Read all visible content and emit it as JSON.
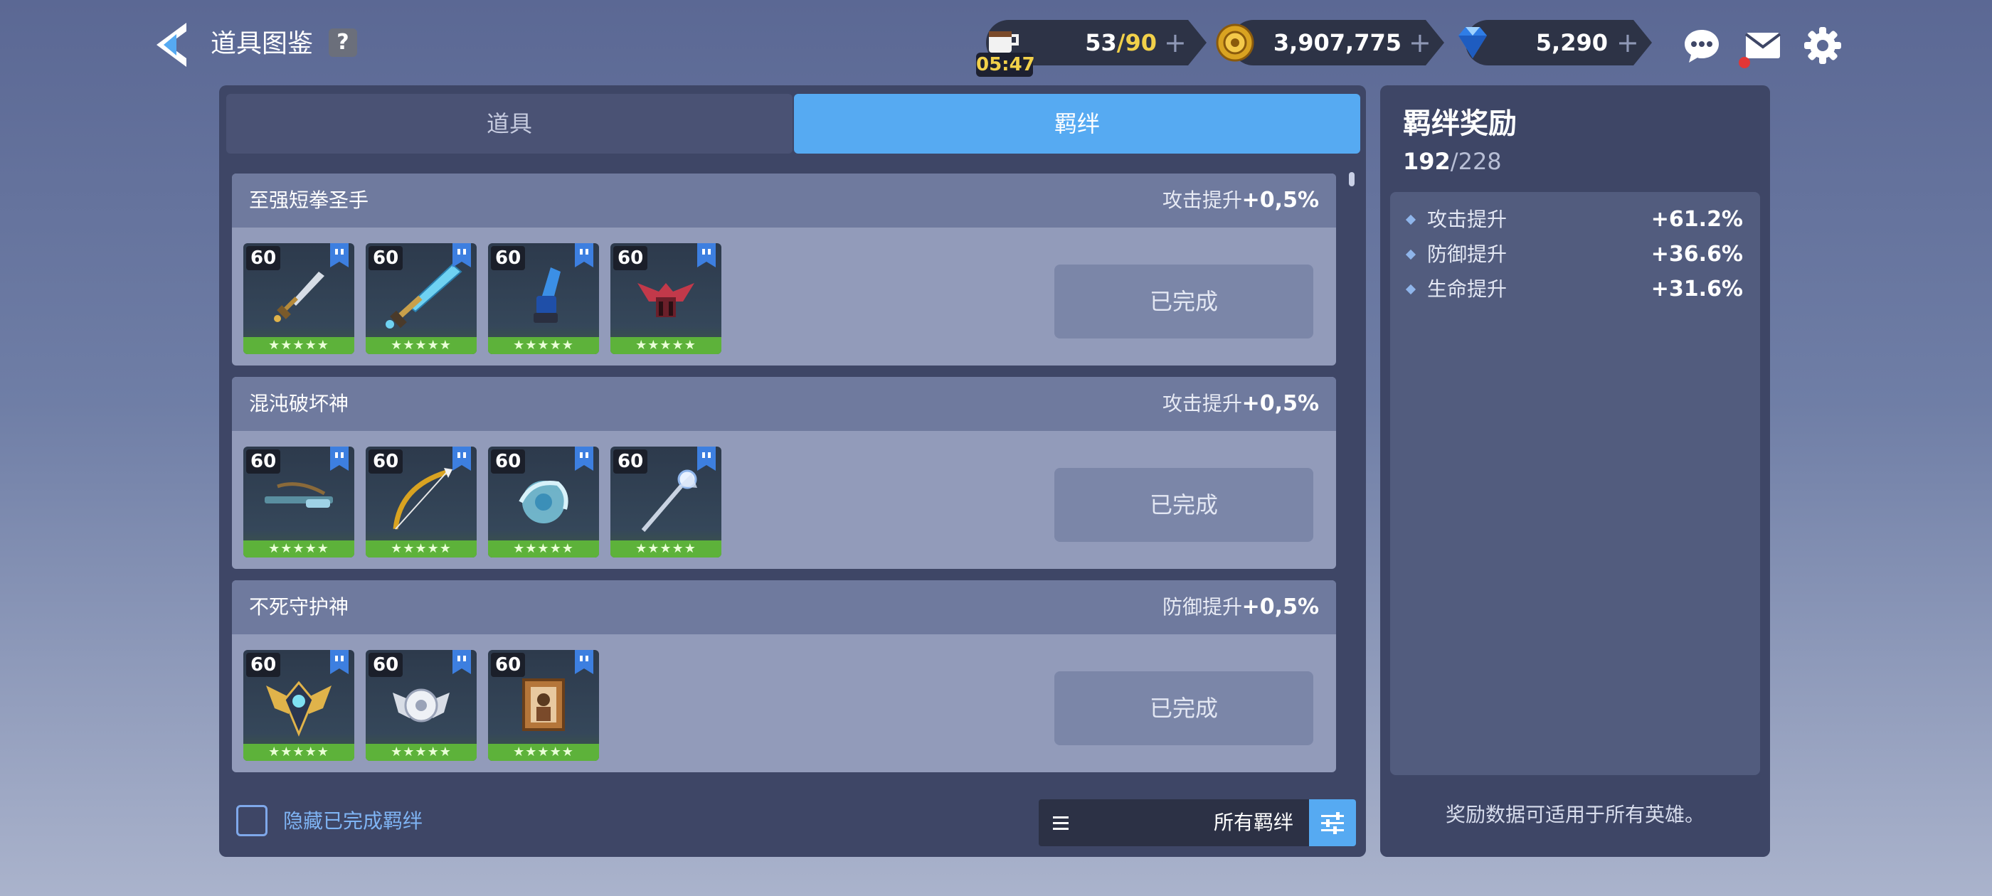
{
  "header": {
    "title": "道具图鉴",
    "help_label": "?"
  },
  "resources": {
    "stamina_current": "53",
    "stamina_sep": "/",
    "stamina_max": "90",
    "stamina_timer": "05:47",
    "coins": "3,907,775",
    "gems": "5,290",
    "plus": "+"
  },
  "colors": {
    "accent": "#56aaf2",
    "stamina_max": "#f2d14a",
    "star_bar": "#5db23a",
    "notification": "#e23636"
  },
  "tabs": [
    {
      "label": "道具",
      "active": false
    },
    {
      "label": "羁绊",
      "active": true
    }
  ],
  "bonds": [
    {
      "name": "至强短拳圣手",
      "stat": "攻击提升",
      "bonus": "+0,5%",
      "status": "已完成",
      "items": [
        {
          "level": "60",
          "stars": "★★★★★",
          "icon": "short-sword-icon"
        },
        {
          "level": "60",
          "stars": "★★★★★",
          "icon": "crystal-greatsword-icon"
        },
        {
          "level": "60",
          "stars": "★★★★★",
          "icon": "blue-gauntlet-icon"
        },
        {
          "level": "60",
          "stars": "★★★★★",
          "icon": "bat-wing-accessory-icon"
        }
      ]
    },
    {
      "name": "混沌破坏神",
      "stat": "攻击提升",
      "bonus": "+0,5%",
      "status": "已完成",
      "items": [
        {
          "level": "60",
          "stars": "★★★★★",
          "icon": "crossbow-icon"
        },
        {
          "level": "60",
          "stars": "★★★★★",
          "icon": "golden-bow-icon"
        },
        {
          "level": "60",
          "stars": "★★★★★",
          "icon": "water-orb-icon"
        },
        {
          "level": "60",
          "stars": "★★★★★",
          "icon": "crystal-staff-icon"
        }
      ]
    },
    {
      "name": "不死守护神",
      "stat": "防御提升",
      "bonus": "+0,5%",
      "status": "已完成",
      "items": [
        {
          "level": "60",
          "stars": "★★★★★",
          "icon": "winged-emblem-icon"
        },
        {
          "level": "60",
          "stars": "★★★★★",
          "icon": "silver-crest-icon"
        },
        {
          "level": "60",
          "stars": "★★★★★",
          "icon": "portrait-frame-icon"
        }
      ]
    }
  ],
  "footer": {
    "hide_completed_label": "隐藏已完成羁绊",
    "filter_label": "所有羁绊"
  },
  "side": {
    "title": "羁绊奖励",
    "count_current": "192",
    "count_sep": "/",
    "count_max": "228",
    "stats": [
      {
        "name": "攻击提升",
        "value": "+61.2%"
      },
      {
        "name": "防御提升",
        "value": "+36.6%"
      },
      {
        "name": "生命提升",
        "value": "+31.6%"
      }
    ],
    "note": "奖励数据可适用于所有英雄。"
  }
}
